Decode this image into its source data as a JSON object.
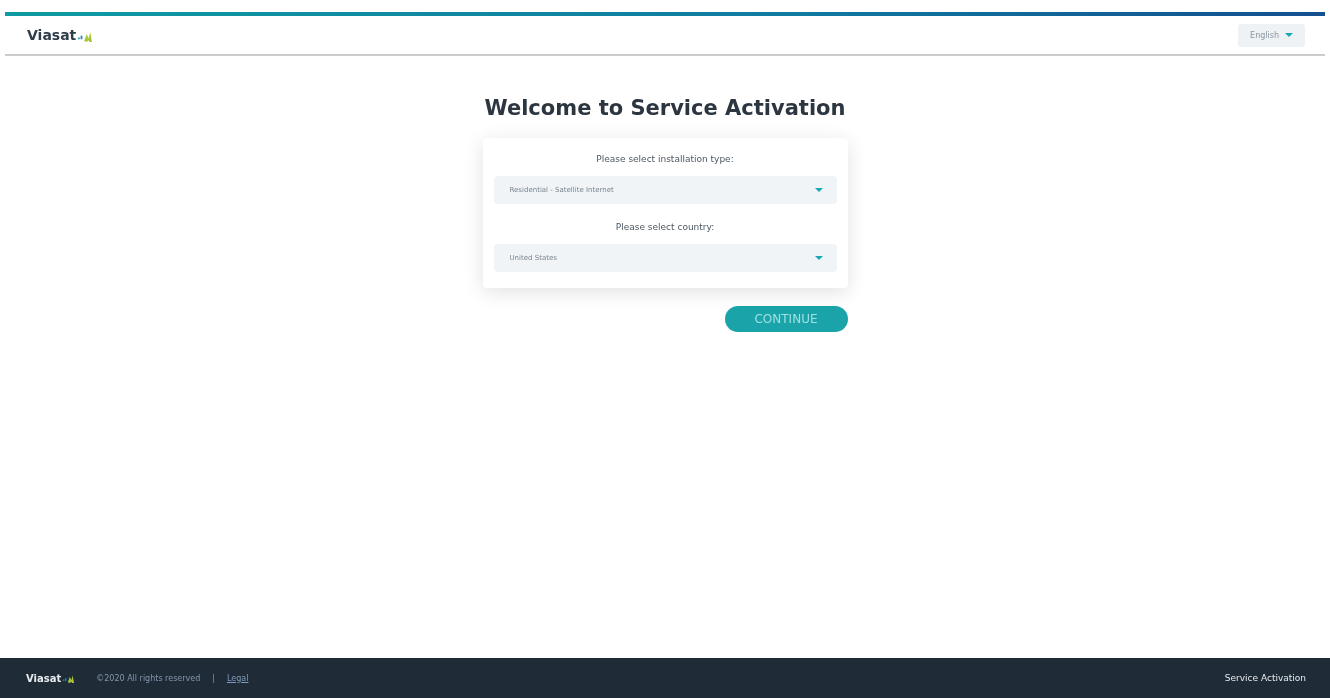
{
  "header": {
    "logo": "Viasat",
    "language": "English"
  },
  "title": "Welcome to Service Activation",
  "form": {
    "fields": [
      {
        "label": "Please select installation type:",
        "value": "Residential - Satellite Internet"
      },
      {
        "label": "Please select country:",
        "value": "United States"
      }
    ]
  },
  "continue_button": "CONTINUE",
  "footer": {
    "logo": "Viasat",
    "copyright": "©2020 All rights reserved",
    "separator": "|",
    "link": "Legal",
    "app_name": "Service Activation"
  }
}
